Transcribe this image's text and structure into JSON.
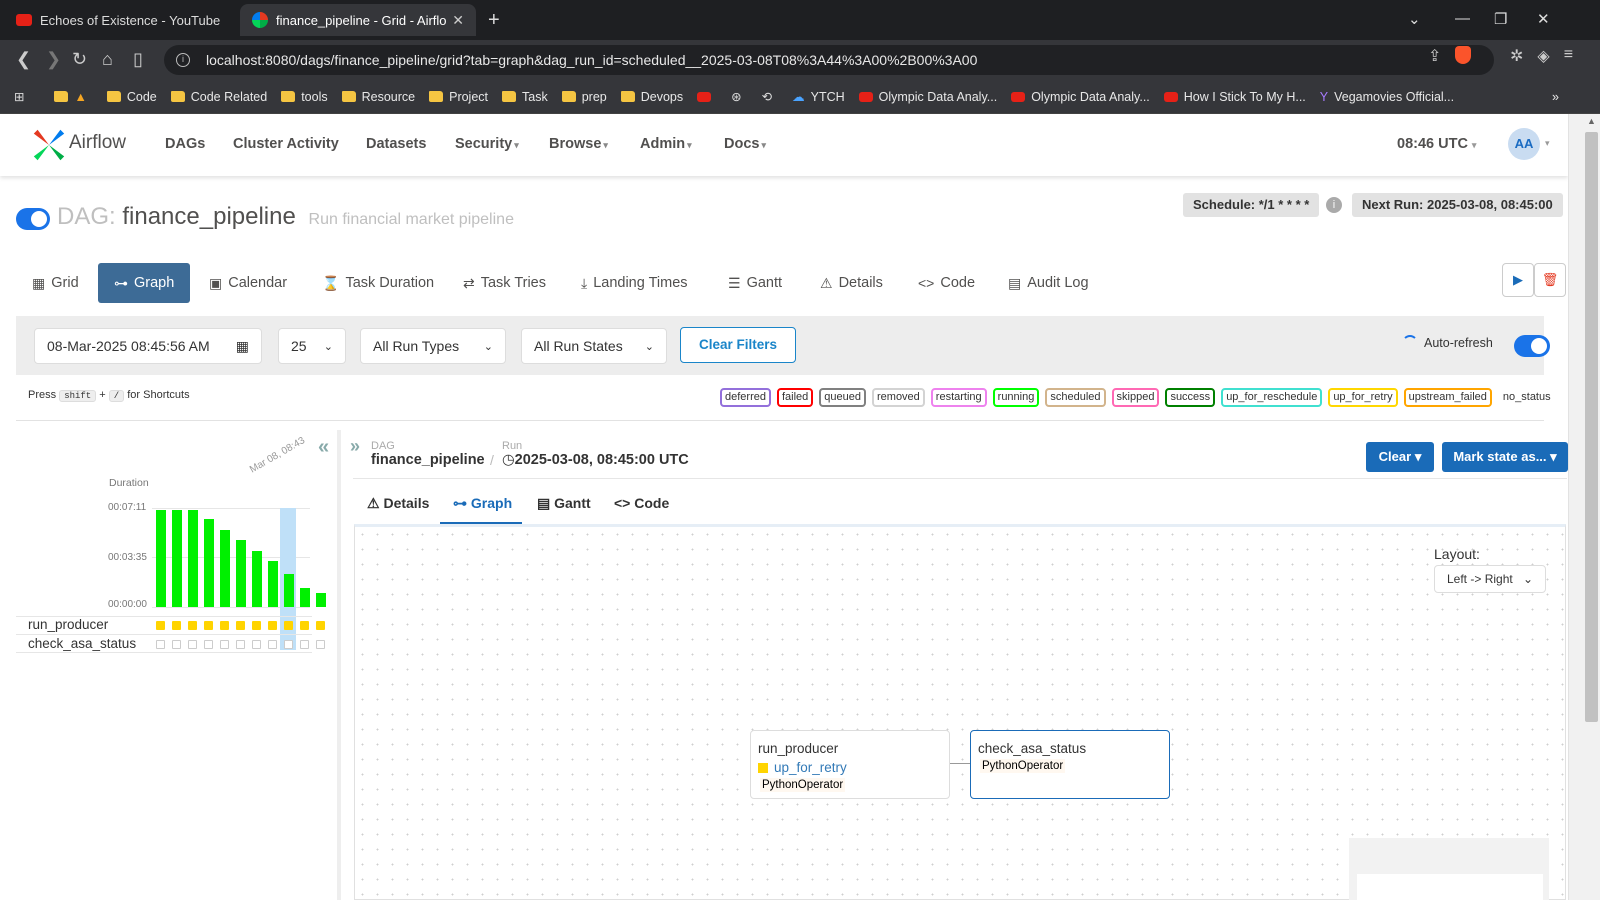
{
  "browser": {
    "tabs": [
      {
        "title": "Echoes of Existence - YouTube"
      },
      {
        "title": "finance_pipeline - Grid - Airflow"
      }
    ],
    "url": "localhost:8080/dags/finance_pipeline/grid?tab=graph&dag_run_id=scheduled__2025-03-08T08%3A44%3A00%2B00%3A00",
    "bookmarks": [
      "Code",
      "Code Related",
      "tools",
      "Resource",
      "Project",
      "Task",
      "prep",
      "Devops",
      "YTCH",
      "Olympic Data Analy...",
      "Olympic Data Analy...",
      "How I Stick To My H...",
      "Vegamovies Official..."
    ]
  },
  "nav": {
    "brand": "Airflow",
    "items": [
      "DAGs",
      "Cluster Activity",
      "Datasets",
      "Security",
      "Browse",
      "Admin",
      "Docs"
    ],
    "time": "08:46 UTC",
    "avatar": "AA"
  },
  "dag": {
    "prefix": "DAG:",
    "name": "finance_pipeline",
    "description": "Run financial market pipeline",
    "schedule": "Schedule: */1 * * * *",
    "next_run": "Next Run: 2025-03-08, 08:45:00"
  },
  "view_tabs": [
    "Grid",
    "Graph",
    "Calendar",
    "Task Duration",
    "Task Tries",
    "Landing Times",
    "Gantt",
    "Details",
    "Code",
    "Audit Log"
  ],
  "filters": {
    "date": "08-Mar-2025 08:45:56 AM",
    "count": "25",
    "run_types": "All Run Types",
    "run_states": "All Run States",
    "clear": "Clear Filters",
    "auto_refresh": "Auto-refresh"
  },
  "shortcuts": {
    "press": "Press",
    "key1": "shift",
    "plus": "+",
    "key2": "/",
    "suffix": "for Shortcuts"
  },
  "states": [
    {
      "label": "deferred",
      "color": "#9370db"
    },
    {
      "label": "failed",
      "color": "#ff0000"
    },
    {
      "label": "queued",
      "color": "#808080"
    },
    {
      "label": "removed",
      "color": "#d3d3d3"
    },
    {
      "label": "restarting",
      "color": "#ee82ee"
    },
    {
      "label": "running",
      "color": "#00ff00"
    },
    {
      "label": "scheduled",
      "color": "#d2b48c"
    },
    {
      "label": "skipped",
      "color": "#ff69b4"
    },
    {
      "label": "success",
      "color": "#008000"
    },
    {
      "label": "up_for_reschedule",
      "color": "#40e0d0"
    },
    {
      "label": "up_for_retry",
      "color": "#ffd700"
    },
    {
      "label": "upstream_failed",
      "color": "#ffa500"
    },
    {
      "label": "no_status",
      "color": "transparent"
    }
  ],
  "grid_panel": {
    "duration_label": "Duration",
    "y_ticks": [
      "00:07:11",
      "00:03:35",
      "00:00:00"
    ],
    "date_label": "Mar 08, 08:43",
    "tasks": [
      "run_producer",
      "check_asa_status"
    ]
  },
  "chart_data": {
    "type": "bar",
    "ylabel": "Duration",
    "yticks": [
      "00:07:11",
      "00:03:35",
      "00:00:00"
    ],
    "values_seconds": [
      422,
      422,
      422,
      382,
      336,
      291,
      245,
      200,
      143,
      82,
      59
    ],
    "highlighted_index": 9
  },
  "detail": {
    "dag_label": "DAG",
    "dag_name": "finance_pipeline",
    "run_label": "Run",
    "run_value": "2025-03-08, 08:45:00 UTC",
    "clear": "Clear",
    "mark_state": "Mark state as...",
    "subtabs": [
      "Details",
      "Graph",
      "Gantt",
      "Code"
    ]
  },
  "graph": {
    "layout_label": "Layout:",
    "layout_value": "Left -> Right",
    "nodes": [
      {
        "name": "run_producer",
        "state": "up_for_retry",
        "operator": "PythonOperator"
      },
      {
        "name": "check_asa_status",
        "state": "",
        "operator": "PythonOperator"
      }
    ]
  }
}
